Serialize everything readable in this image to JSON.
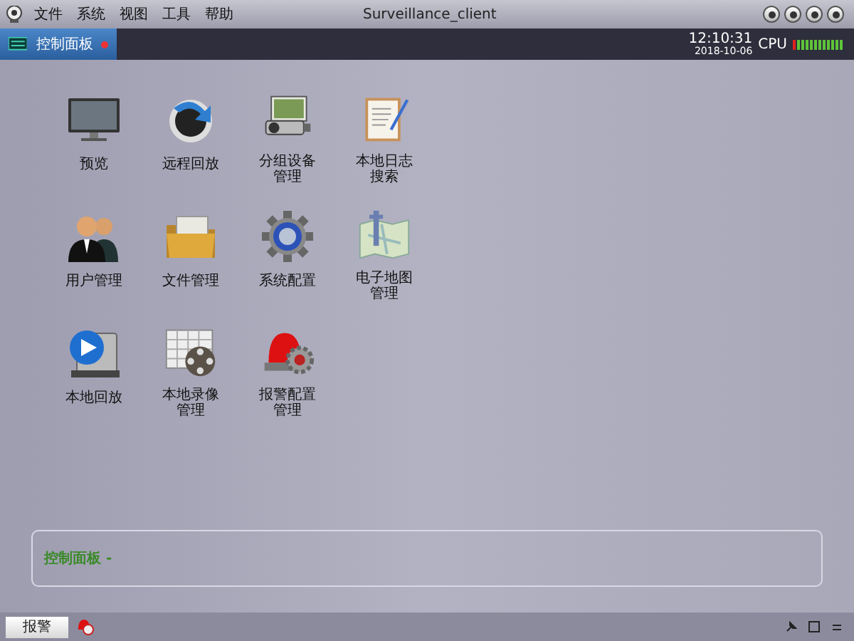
{
  "window": {
    "title": "Surveillance_client"
  },
  "menu": [
    "文件",
    "系统",
    "视图",
    "工具",
    "帮助"
  ],
  "tabs": [
    {
      "label": "控制面板",
      "selected": true
    }
  ],
  "clock": {
    "time": "12:10:31",
    "date": "2018-10-06"
  },
  "cpu": {
    "label": "CPU",
    "level": 0.08
  },
  "modules": [
    {
      "kind": "monitor",
      "label": "预览"
    },
    {
      "kind": "replay",
      "label": "远程回放"
    },
    {
      "kind": "devices",
      "label": "分组设备管理"
    },
    {
      "kind": "log",
      "label": "本地日志搜索"
    },
    {
      "kind": "users",
      "label": "用户管理"
    },
    {
      "kind": "folder",
      "label": "文件管理"
    },
    {
      "kind": "gear",
      "label": "系统配置"
    },
    {
      "kind": "map",
      "label": "电子地图管理"
    },
    {
      "kind": "playback",
      "label": "本地回放"
    },
    {
      "kind": "recording",
      "label": "本地录像管理"
    },
    {
      "kind": "alarm",
      "label": "报警配置管理"
    }
  ],
  "info_panel": {
    "text": "控制面板 -"
  },
  "status_bar": {
    "button": "报警"
  }
}
